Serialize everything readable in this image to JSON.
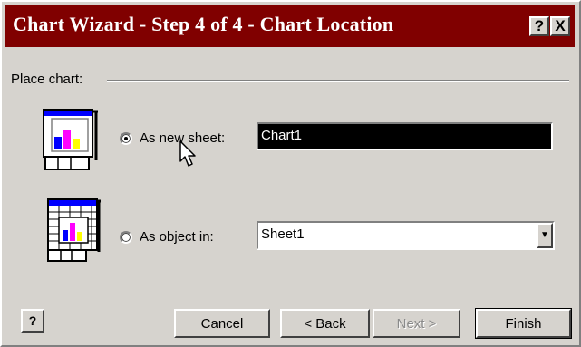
{
  "window": {
    "title": "Chart Wizard - Step 4 of 4 - Chart Location",
    "help_button": "?",
    "close_button": "X"
  },
  "place_chart": {
    "group_label": "Place chart:",
    "options": [
      {
        "label": "As new sheet:",
        "selected": true,
        "value": "Chart1",
        "icon": "new-sheet-chart-icon"
      },
      {
        "label": "As object in:",
        "selected": false,
        "value": "Sheet1",
        "icon": "embedded-chart-icon"
      }
    ]
  },
  "buttons": {
    "help": "?",
    "cancel": "Cancel",
    "back": "< Back",
    "next": "Next >",
    "finish": "Finish"
  },
  "colors": {
    "title_bar": "#800000",
    "dialog_face": "#d6d3ce",
    "bar_blue": "#0000ff",
    "bar_magenta": "#ff00ff",
    "bar_yellow": "#ffff00"
  }
}
